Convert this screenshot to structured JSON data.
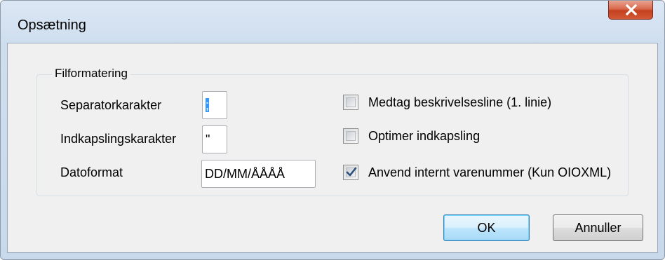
{
  "window": {
    "title": "Opsætning",
    "close_icon": "close-x-icon"
  },
  "group": {
    "label": "Filformatering"
  },
  "fields": {
    "separator": {
      "label": "Separatorkarakter",
      "value": ";"
    },
    "encapsulation": {
      "label": "Indkapslingskarakter",
      "value": "\""
    },
    "date_format": {
      "label": "Datoformat",
      "value": "DD/MM/ÅÅÅÅ"
    }
  },
  "options": [
    {
      "label": "Medtag beskrivelsesline (1. linie)",
      "checked": false
    },
    {
      "label": "Optimer indkapsling",
      "checked": false
    },
    {
      "label": "Anvend internt varenummer (Kun OIOXML)",
      "checked": true
    }
  ],
  "buttons": {
    "ok_label": "OK",
    "cancel_label": "Annuller"
  }
}
